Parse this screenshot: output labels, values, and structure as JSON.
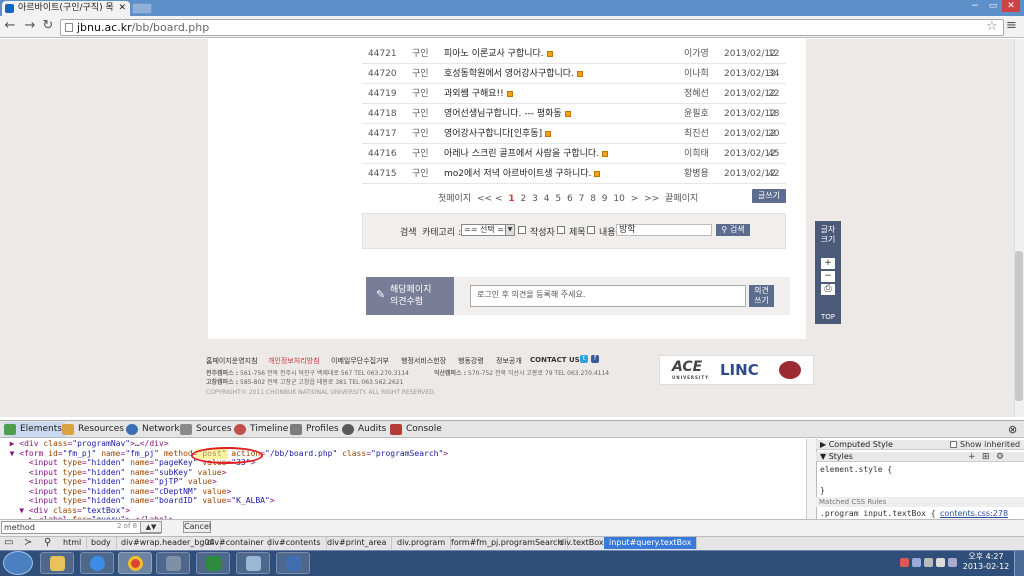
{
  "browser": {
    "tab_title": "아르바이트(구인/구직) 목",
    "url_domain": "jbnu.ac.kr",
    "url_path": "/bb/board.php"
  },
  "board": {
    "rows": [
      {
        "no": "44721",
        "type": "구인",
        "title": "피아노 이론교사 구합니다.",
        "author": "이가영",
        "date": "2013/02/12",
        "views": "12"
      },
      {
        "no": "44720",
        "type": "구인",
        "title": "호성동학원에서 영어강사구합니다.",
        "author": "이나희",
        "date": "2013/02/12",
        "views": "34"
      },
      {
        "no": "44719",
        "type": "구인",
        "title": "과외쌤 구해요!!",
        "author": "정혜선",
        "date": "2013/02/12",
        "views": "22"
      },
      {
        "no": "44718",
        "type": "구인",
        "title": "영어선생님구합니다. --- 평화동",
        "author": "윤필호",
        "date": "2013/02/12",
        "views": "18"
      },
      {
        "no": "44717",
        "type": "구인",
        "title": "영어강사구합니다[인후동]",
        "author": "최진선",
        "date": "2013/02/12",
        "views": "20"
      },
      {
        "no": "44716",
        "type": "구인",
        "title": "아레나 스크린 골프에서 사람을 구합니다.",
        "author": "이희태",
        "date": "2013/02/12",
        "views": "45"
      },
      {
        "no": "44715",
        "type": "구인",
        "title": "mo2에서 저녁 아르바이트생 구하니다.",
        "author": "황병용",
        "date": "2013/02/12",
        "views": "42"
      }
    ],
    "pager": {
      "first": "첫페이지",
      "prev_prev": "<<",
      "prev": "<",
      "pages": [
        "1",
        "2",
        "3",
        "4",
        "5",
        "6",
        "7",
        "8",
        "9",
        "10"
      ],
      "next": ">",
      "next_next": ">>",
      "last": "끝페이지"
    },
    "write_label": "글쓰기"
  },
  "search": {
    "label": "검색",
    "category_label": "카테고리 :",
    "category_value": "== 선택 ==",
    "opt_author": "작성자",
    "opt_title": "제목",
    "opt_content": "내용",
    "query_value": "방학",
    "button_label": "검색"
  },
  "opinion": {
    "logo_line1": "해당페이지",
    "logo_line2": "의견수렴",
    "placeholder": "로그인 후 의견을 등록해 주세요.",
    "button_line1": "의견",
    "button_line2": "쓰기"
  },
  "font_size_widget": {
    "title_line1": "글자",
    "title_line2": "크기",
    "plus": "+",
    "minus": "−",
    "print": "⎙",
    "top_label": "TOP"
  },
  "footer": {
    "links": [
      "홈페이지운영지침",
      "개인정보처리방침",
      "이메일무단수집거부",
      "행정서비스헌장",
      "행동강령",
      "정보공개",
      "CONTACT US"
    ],
    "campus1_label": "전주캠퍼스 :",
    "campus1_addr": "561-756 전북 전주시 덕진구 백제대로 567  TEL 063.270.3114",
    "campus2_label": "익산캠퍼스 :",
    "campus2_addr": "570-752 전북 익산시 고봉로 79  TEL 063.270.4114",
    "campus3_label": "고창캠퍼스 :",
    "campus3_addr": "585-802 전북 고창군 고창읍 태봉로 381  TEL 063.562.2621",
    "copyright": "COPYRIGHT© 2011 CHONBUK NATIONAL UNIVERSITY. ALL RIGHT RESERVED.",
    "logo_ace": "ACE",
    "logo_ace_sub": "UNIVERSITY",
    "logo_linc": "LINC"
  },
  "devtools": {
    "tabs": [
      "Elements",
      "Resources",
      "Network",
      "Sources",
      "Timeline",
      "Profiles",
      "Audits",
      "Console"
    ],
    "panel_computed": "Computed Style",
    "show_inherited": "Show inherited",
    "panel_styles": "Styles",
    "element_style": "element.style {",
    "element_style_close": "}",
    "matched_rules": "Matched CSS Rules",
    "rule_selector": ".program input.textBox {",
    "rule_source": "contents.css:278",
    "find_value": "method",
    "find_count": "2 of 8",
    "cancel_label": "Cancel",
    "breadcrumbs": [
      "html",
      "body",
      "div#wrap.header_bg04",
      "div#container",
      "div#contents",
      "div#print_area",
      "div.program",
      "form#fm_pj.programSearch",
      "div.textBox",
      "input#query.textBox"
    ]
  },
  "taskbar": {
    "time": "오후 4:27",
    "date": "2013-02-12"
  }
}
